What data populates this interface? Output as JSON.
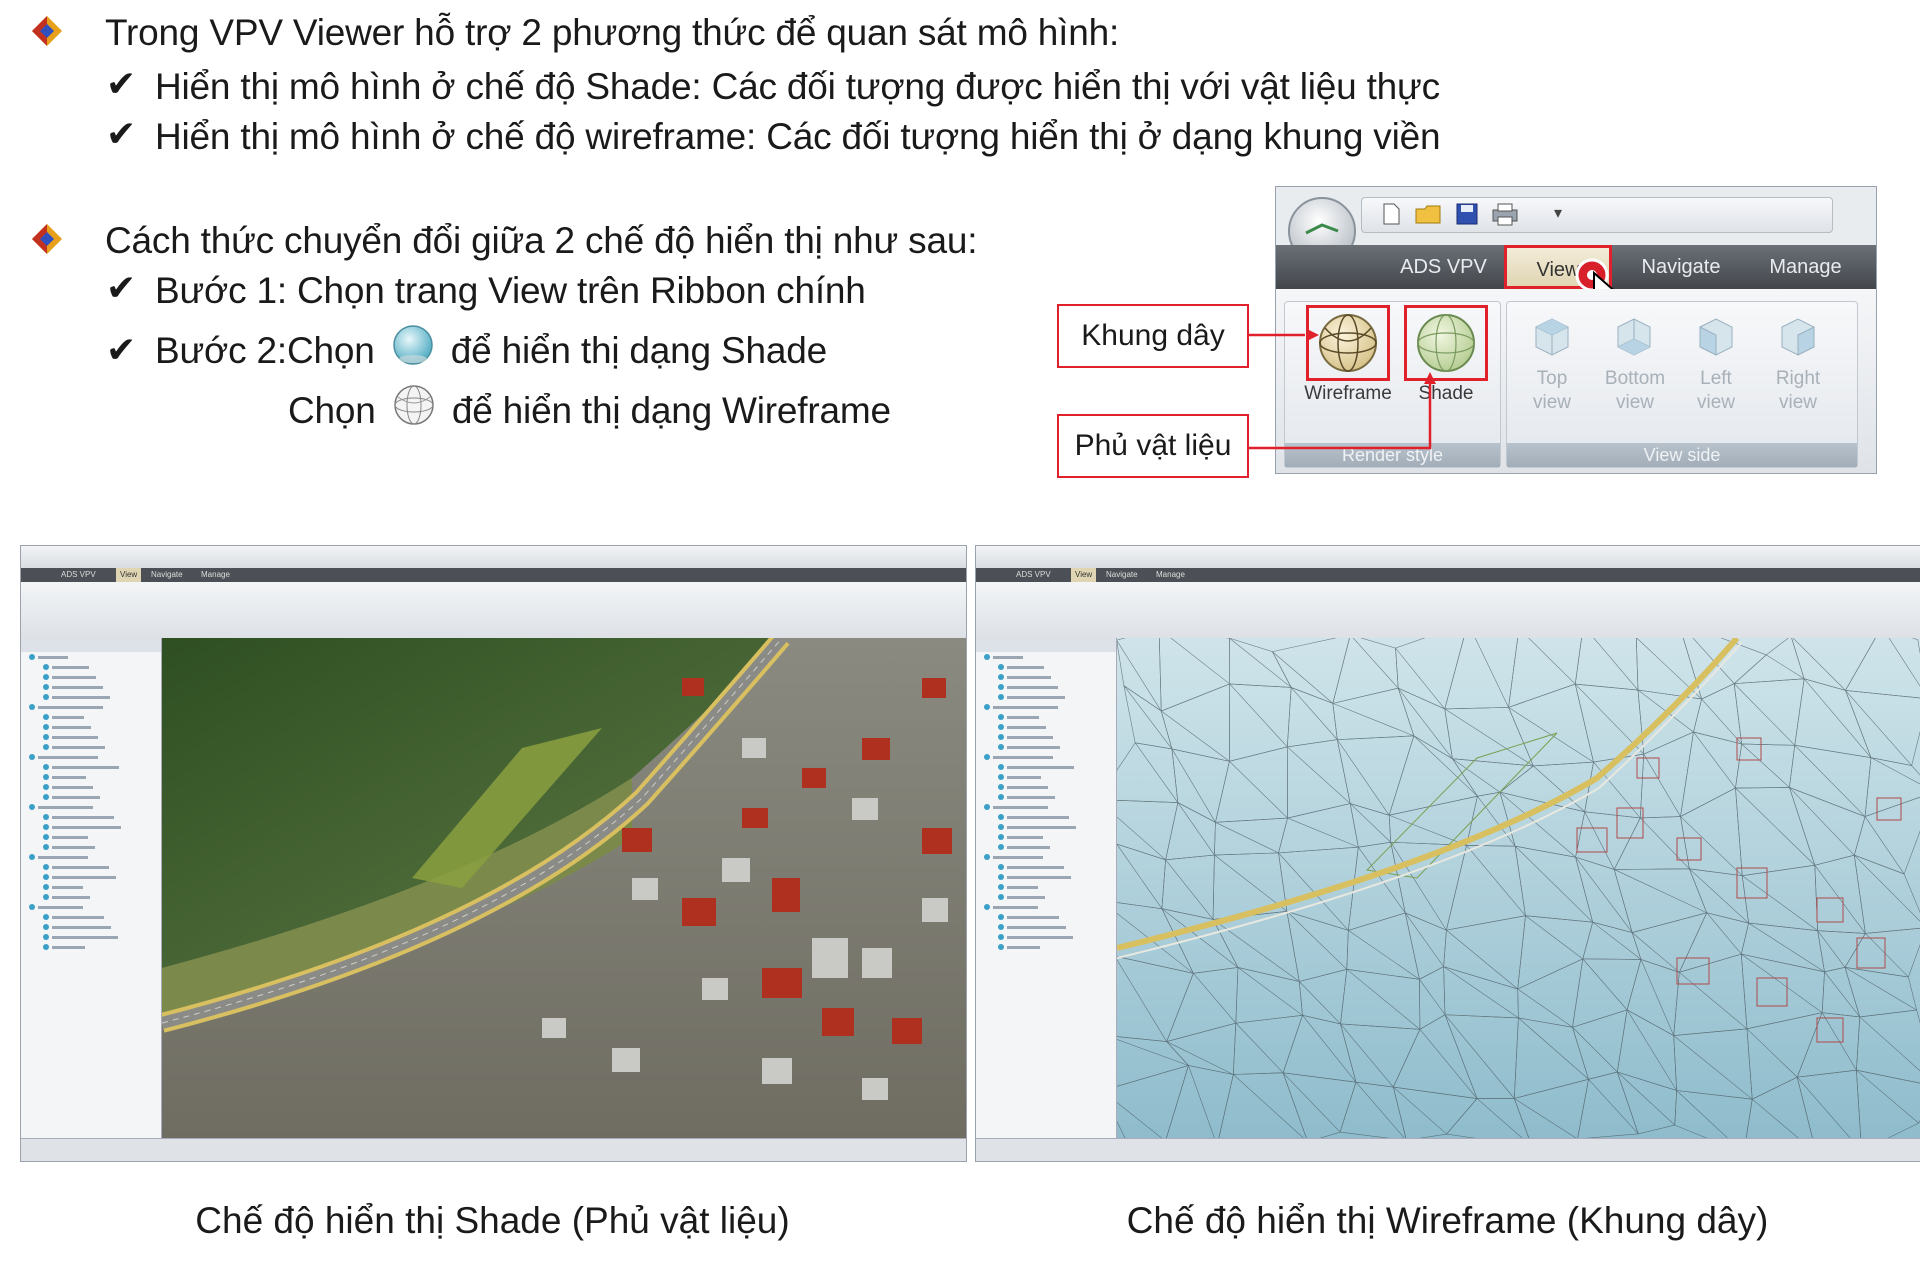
{
  "bullets": [
    {
      "text": "Trong VPV Viewer hỗ trợ 2 phương thức để quan sát mô hình:",
      "items": [
        "Hiển thị mô hình ở chế độ Shade: Các đối tượng được hiển thị với vật liệu thực",
        "Hiển thị mô hình ở chế độ wireframe: Các đối tượng hiển thị ở dạng khung viền"
      ]
    },
    {
      "text": "Cách thức chuyển đổi giữa 2 chế độ hiển thị như sau:",
      "items": [
        "Bước 1: Chọn trang View trên Ribbon chính",
        "Bước 2:Chọn",
        "để hiển thị dạng Shade",
        "Chọn",
        "để hiển thị dạng Wireframe"
      ]
    }
  ],
  "ribbon": {
    "tabs": [
      "ADS VPV",
      "View",
      "Navigate",
      "Manage"
    ],
    "active_tab": "View",
    "render_group": {
      "label": "Render style",
      "buttons": [
        "Wireframe",
        "Shade"
      ]
    },
    "view_group": {
      "label": "View side",
      "buttons": [
        {
          "line1": "Top",
          "line2": "view"
        },
        {
          "line1": "Bottom",
          "line2": "view"
        },
        {
          "line1": "Left",
          "line2": "view"
        },
        {
          "line1": "Right",
          "line2": "view"
        }
      ]
    },
    "qat_icons": [
      "new-file-icon",
      "open-folder-icon",
      "save-icon",
      "print-icon",
      "dropdown-icon"
    ]
  },
  "callouts": {
    "wireframe": "Khung dây",
    "shade": "Phủ vật liệu"
  },
  "screenshots": [
    {
      "mode": "shade",
      "caption": "Chế độ hiển thị Shade (Phủ vật liệu)"
    },
    {
      "mode": "wireframe",
      "caption": "Chế độ hiển thị Wireframe (Khung dây)"
    }
  ],
  "colors": {
    "callout_red": "#e0202a",
    "text": "#1a1a1a",
    "road": "#d8c060",
    "roof_red": "#b03020",
    "terrain_green": "#3f6b2e",
    "wire_bg": "#a9cdd8"
  }
}
